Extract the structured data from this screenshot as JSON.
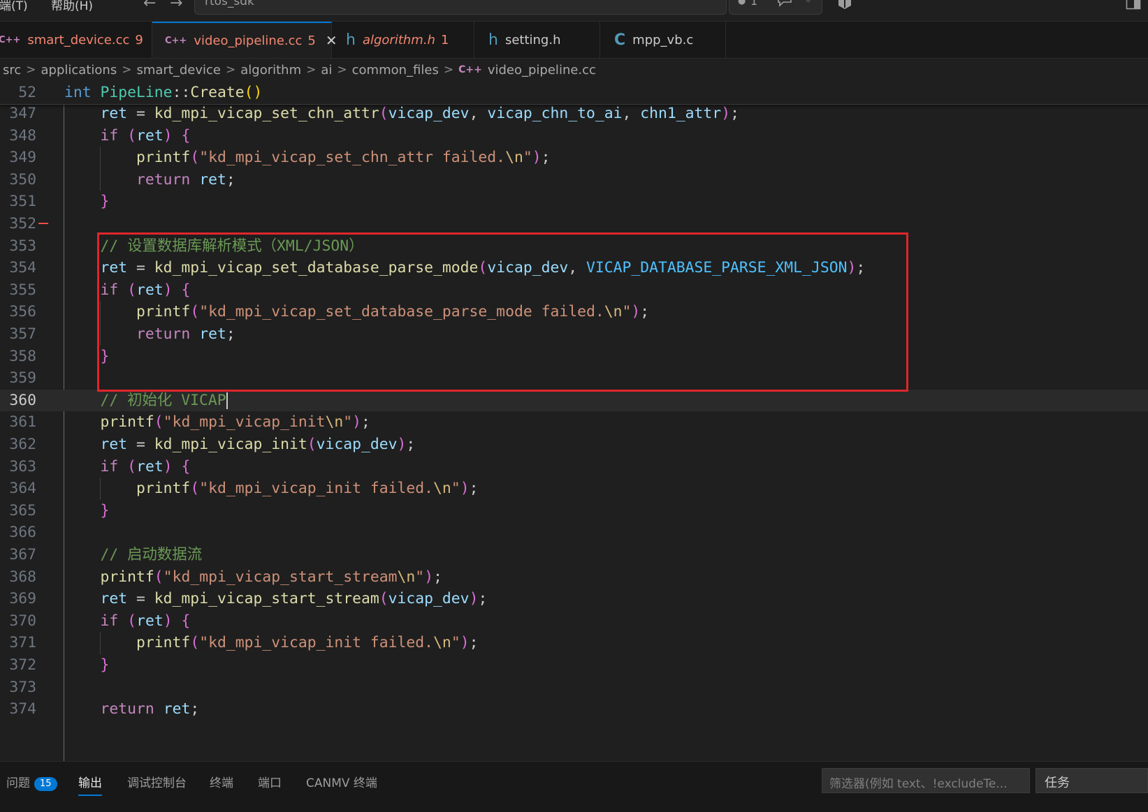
{
  "menu": {
    "terminal": "终端(T)",
    "help": "帮助(H)"
  },
  "command_center": {
    "text": "rtos_sdk",
    "notification_count": "1"
  },
  "tabs": [
    {
      "icon": "C++",
      "label": "smart_device.cc",
      "badge": "9",
      "color": "#f48771"
    },
    {
      "icon": "C++",
      "label": "video_pipeline.cc",
      "badge": "5",
      "color": "#f48771"
    },
    {
      "icon": "h",
      "label": "algorithm.h",
      "badge": "1",
      "color": "#f48771"
    },
    {
      "icon": "h",
      "label": "setting.h",
      "badge": "",
      "color": "#cccccc"
    },
    {
      "icon": "C",
      "label": "mpp_vb.c",
      "badge": "",
      "color": "#cccccc"
    }
  ],
  "breadcrumb": [
    "src",
    "applications",
    "smart_device",
    "algorithm",
    "ai",
    "common_files",
    "video_pipeline.cc"
  ],
  "editor": {
    "sticky_line": "52",
    "cursor_line": "360",
    "lines": [
      {
        "n": "347",
        "t": "    ret = kd_mpi_vicap_set_chn_attr(vicap_dev, vicap_chn_to_ai, chn1_attr);"
      },
      {
        "n": "348",
        "t": "    if (ret) {"
      },
      {
        "n": "349",
        "t": "        printf(\"kd_mpi_vicap_set_chn_attr failed.\\n\");"
      },
      {
        "n": "350",
        "t": "        return ret;"
      },
      {
        "n": "351",
        "t": "    }"
      },
      {
        "n": "352",
        "t": ""
      },
      {
        "n": "353",
        "t": "    // 设置数据库解析模式（XML/JSON）"
      },
      {
        "n": "354",
        "t": "    ret = kd_mpi_vicap_set_database_parse_mode(vicap_dev, VICAP_DATABASE_PARSE_XML_JSON);"
      },
      {
        "n": "355",
        "t": "    if (ret) {"
      },
      {
        "n": "356",
        "t": "        printf(\"kd_mpi_vicap_set_database_parse_mode failed.\\n\");"
      },
      {
        "n": "357",
        "t": "        return ret;"
      },
      {
        "n": "358",
        "t": "    }"
      },
      {
        "n": "359",
        "t": ""
      },
      {
        "n": "360",
        "t": "    // 初始化 VICAP"
      },
      {
        "n": "361",
        "t": "    printf(\"kd_mpi_vicap_init\\n\");"
      },
      {
        "n": "362",
        "t": "    ret = kd_mpi_vicap_init(vicap_dev);"
      },
      {
        "n": "363",
        "t": "    if (ret) {"
      },
      {
        "n": "364",
        "t": "        printf(\"kd_mpi_vicap_init failed.\\n\");"
      },
      {
        "n": "365",
        "t": "    }"
      },
      {
        "n": "366",
        "t": ""
      },
      {
        "n": "367",
        "t": "    // 启动数据流"
      },
      {
        "n": "368",
        "t": "    printf(\"kd_mpi_vicap_start_stream\\n\");"
      },
      {
        "n": "369",
        "t": "    ret = kd_mpi_vicap_start_stream(vicap_dev);"
      },
      {
        "n": "370",
        "t": "    if (ret) {"
      },
      {
        "n": "371",
        "t": "        printf(\"kd_mpi_vicap_init failed.\\n\");"
      },
      {
        "n": "372",
        "t": "    }"
      },
      {
        "n": "373",
        "t": ""
      },
      {
        "n": "374",
        "t": "    return ret;"
      }
    ]
  },
  "panel": {
    "tabs": [
      {
        "label": "问题",
        "count": "15"
      },
      {
        "label": "输出"
      },
      {
        "label": "调试控制台"
      },
      {
        "label": "终端"
      },
      {
        "label": "端口"
      },
      {
        "label": "CANMV 终端"
      }
    ],
    "filter_placeholder": "筛选器(例如 text、!excludeTe...",
    "task_select": "任务"
  },
  "colors": {
    "accent": "#0078d4",
    "error": "#f14c4c",
    "highlight_box": "#e0252c"
  }
}
